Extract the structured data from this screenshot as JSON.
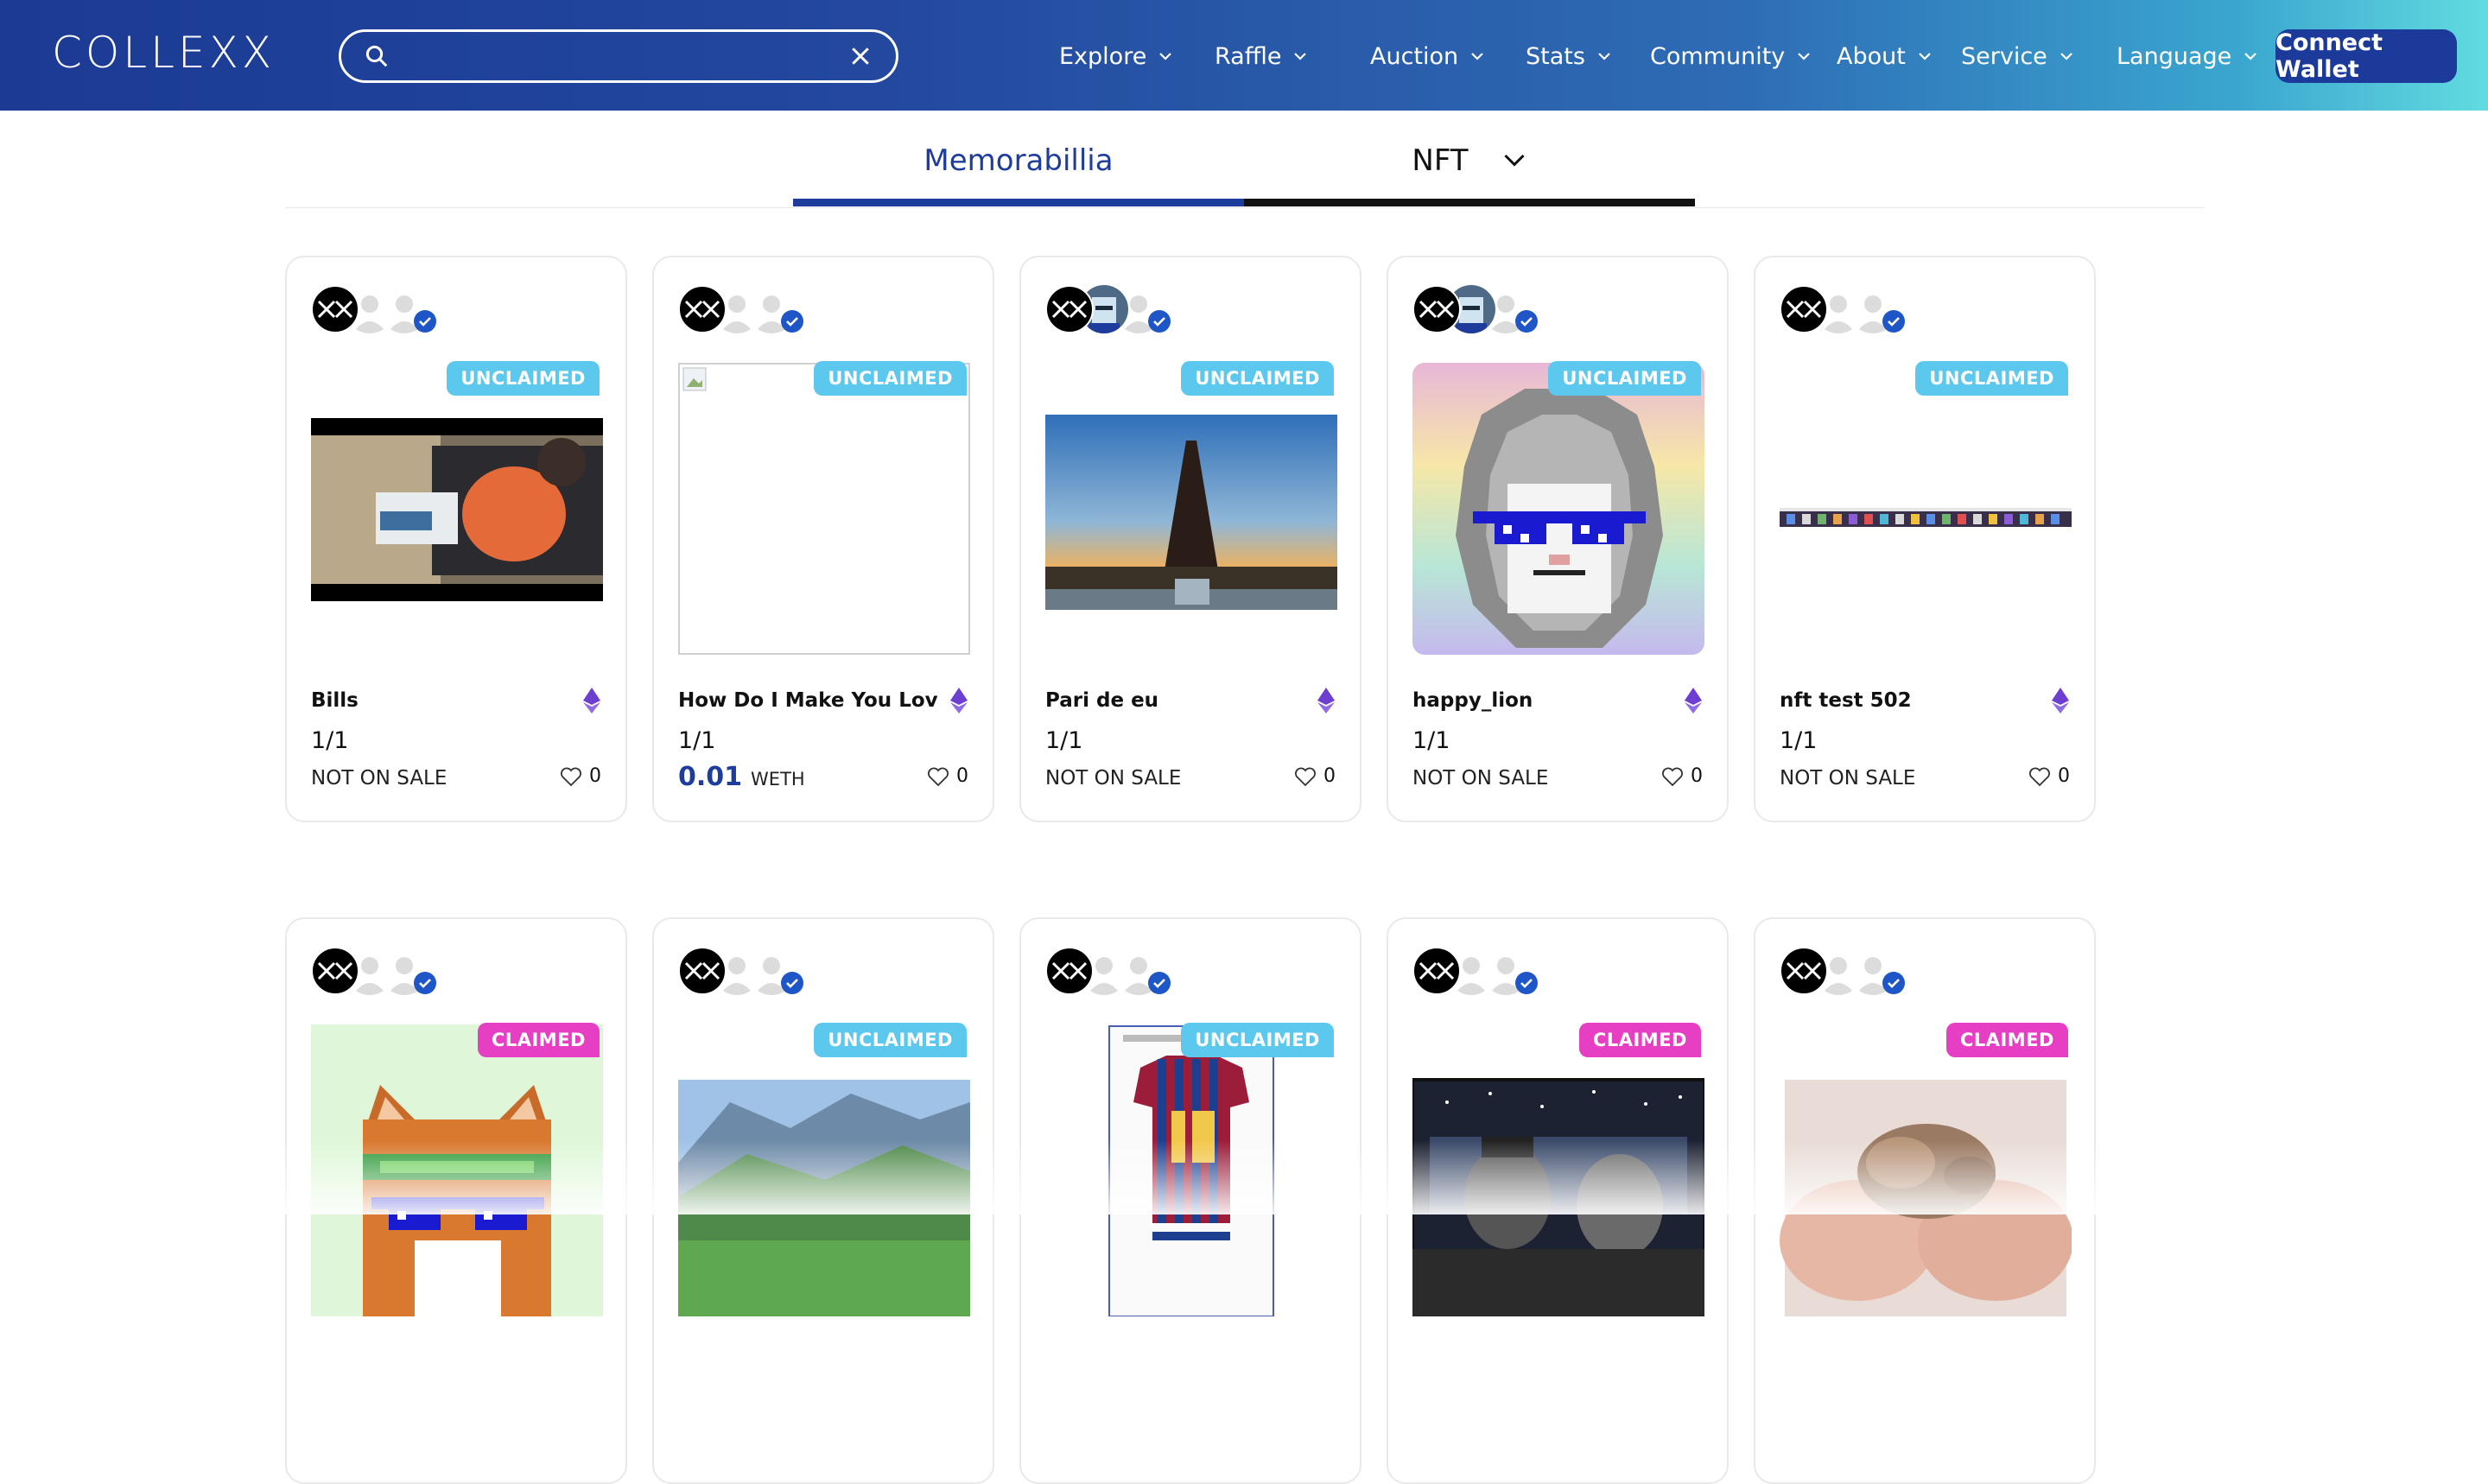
{
  "header": {
    "logo_text": "COLLEXX",
    "search": {
      "placeholder": "",
      "value": ""
    },
    "nav": [
      "Explore",
      "Raffle",
      "Auction",
      "Stats",
      "Community",
      "About",
      "Service",
      "Language"
    ],
    "connect_label": "Connect Wallet"
  },
  "tabs": {
    "active": "Memorabillia",
    "second": "NFT"
  },
  "cards": [
    {
      "status": "UNCLAIMED",
      "title": "Bills",
      "edition": "1/1",
      "sale": "NOT ON SALE",
      "likes": "0",
      "media": "video-still"
    },
    {
      "status": "UNCLAIMED",
      "title": "How Do I Make You Love ...",
      "edition": "1/1",
      "price": "0.01",
      "currency": "WETH",
      "likes": "0",
      "media": "broken-image"
    },
    {
      "status": "UNCLAIMED",
      "title": "Pari de eu",
      "edition": "1/1",
      "sale": "NOT ON SALE",
      "likes": "0",
      "media": "eiffel-tower"
    },
    {
      "status": "UNCLAIMED",
      "title": "happy_lion",
      "edition": "1/1",
      "sale": "NOT ON SALE",
      "likes": "0",
      "media": "pixel-lion"
    },
    {
      "status": "UNCLAIMED",
      "title": "nft test 502",
      "edition": "1/1",
      "sale": "NOT ON SALE",
      "likes": "0",
      "media": "screenshot-strip"
    },
    {
      "status": "CLAIMED",
      "media": "pixel-shiba"
    },
    {
      "status": "UNCLAIMED",
      "media": "mountain-valley"
    },
    {
      "status": "UNCLAIMED",
      "media": "messi-jersey-certificate"
    },
    {
      "status": "CLAIMED",
      "media": "car-interior-art"
    },
    {
      "status": "CLAIMED",
      "media": "baby-animal-hands"
    }
  ],
  "colors": {
    "brand": "#1e3c9c",
    "unclaimed": "#5cc8ee",
    "claimed": "#e73fc4",
    "eth": "#6c3fd1"
  }
}
